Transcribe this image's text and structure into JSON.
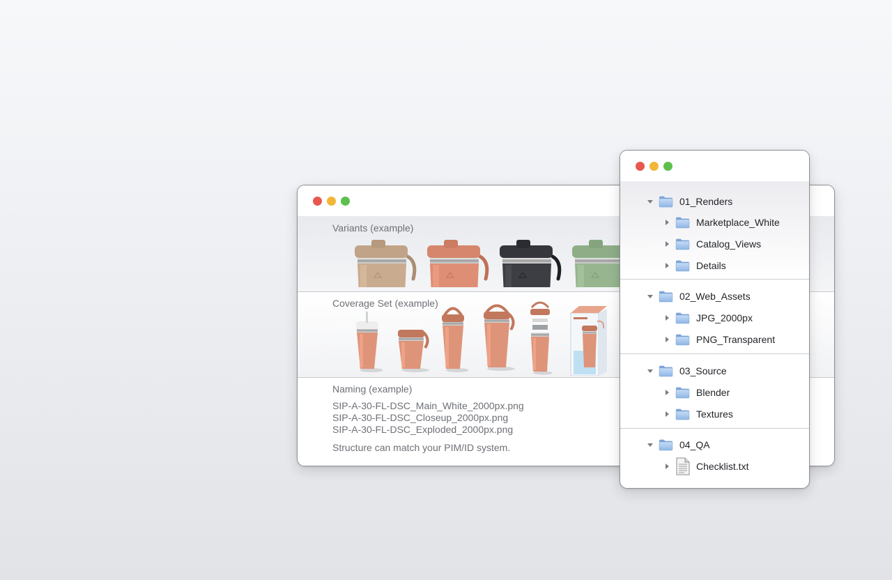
{
  "main_window": {
    "variants_label": "Variants (example)",
    "coverage_label": "Coverage Set (example)",
    "naming_label": "Naming (example)",
    "filenames": [
      "SIP-A-30-FL-DSC_Main_White_2000px.png",
      "SIP-A-30-FL-DSC_Closeup_2000px.png",
      "SIP-A-30-FL-DSC_Exploded_2000px.png"
    ],
    "note": "Structure can match your PIM/ID system.",
    "variant_colors": [
      "#c9ab8f",
      "#dd8e74",
      "#3c3e43",
      "#97b690"
    ],
    "product_color": "#de9479"
  },
  "file_browser": {
    "groups": [
      {
        "name": "01_Renders",
        "expanded": true,
        "children": [
          {
            "name": "Marketplace_White",
            "type": "folder"
          },
          {
            "name": "Catalog_Views",
            "type": "folder"
          },
          {
            "name": "Details",
            "type": "folder"
          }
        ]
      },
      {
        "name": "02_Web_Assets",
        "expanded": true,
        "children": [
          {
            "name": "JPG_2000px",
            "type": "folder"
          },
          {
            "name": "PNG_Transparent",
            "type": "folder"
          }
        ]
      },
      {
        "name": "03_Source",
        "expanded": true,
        "children": [
          {
            "name": "Blender",
            "type": "folder"
          },
          {
            "name": "Textures",
            "type": "folder"
          }
        ]
      },
      {
        "name": "04_QA",
        "expanded": true,
        "children": [
          {
            "name": "Checklist.txt",
            "type": "file"
          }
        ]
      }
    ]
  },
  "icons": {
    "window_controls": [
      "close",
      "minimize",
      "maximize"
    ],
    "folder": "folder-icon",
    "file": "text-file-icon",
    "expanded": "triangle-down-icon",
    "collapsed": "triangle-right-icon"
  },
  "colors": {
    "close": "#e8584e",
    "minimize": "#f2b737",
    "maximize": "#5bc14c",
    "folder": "#8fb6e6"
  }
}
